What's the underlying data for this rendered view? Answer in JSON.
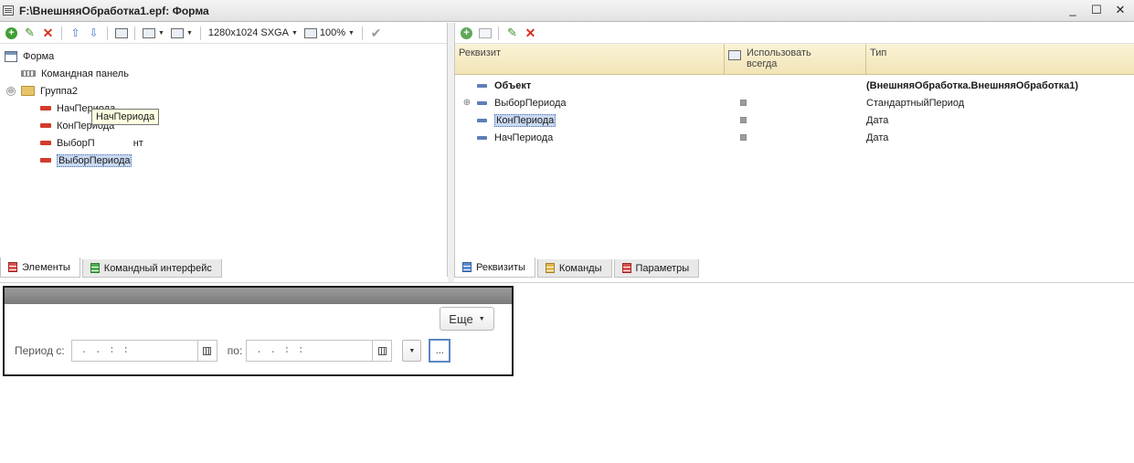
{
  "window": {
    "title": "F:\\ВнешняяОбработка1.epf: Форма",
    "controls": {
      "minimize": "_",
      "maximize": "☐",
      "close": "✕"
    }
  },
  "left_toolbar": {
    "resolution": "1280x1024 SXGA",
    "zoom": "100%"
  },
  "element_tree": {
    "items": [
      {
        "label": "Форма",
        "icon": "form-icon",
        "indent": 0
      },
      {
        "label": "Командная панель",
        "icon": "command-panel-icon",
        "indent": 1
      },
      {
        "label": "Группа2",
        "icon": "folder-icon",
        "indent": 0,
        "expander": "⊖"
      },
      {
        "label": "НачПериода",
        "icon": "field-icon",
        "indent": 2
      },
      {
        "label": "КонПериода",
        "icon": "field-icon",
        "indent": 2
      },
      {
        "label": "ВыборПериодаЭлемент",
        "visible_prefix": "ВыборП",
        "visible_suffix": "нт",
        "icon": "field-icon",
        "indent": 2
      },
      {
        "label": "ВыборПериода",
        "icon": "field-icon",
        "indent": 2,
        "selected": true
      }
    ],
    "tooltip": "НачПериода"
  },
  "left_tabs": [
    {
      "label": "Элементы",
      "icon": "elements-tab-icon",
      "active": true
    },
    {
      "label": "Командный интерфейс",
      "icon": "command-interface-tab-icon",
      "active": false
    }
  ],
  "attributes_grid": {
    "headers": {
      "name": "Реквизит",
      "use_always_line1": "Использовать",
      "use_always_line2": "всегда",
      "type": "Тип"
    },
    "rows": [
      {
        "name": "Объект",
        "type": "(ВнешняяОбработка.ВнешняяОбработка1)",
        "bold": true,
        "check": false,
        "expand": ""
      },
      {
        "name": "ВыборПериода",
        "type": "СтандартныйПериод",
        "bold": false,
        "check": true,
        "expand": "⊕"
      },
      {
        "name": "КонПериода",
        "type": "Дата",
        "bold": false,
        "check": true,
        "expand": "",
        "selected": true
      },
      {
        "name": "НачПериода",
        "type": "Дата",
        "bold": false,
        "check": true,
        "expand": ""
      }
    ]
  },
  "right_tabs": [
    {
      "label": "Реквизиты",
      "icon": "attributes-tab-icon",
      "active": true
    },
    {
      "label": "Команды",
      "icon": "commands-tab-icon",
      "active": false
    },
    {
      "label": "Параметры",
      "icon": "parameters-tab-icon",
      "active": false
    }
  ],
  "form_preview": {
    "more_button": "Еще",
    "period_from_label": "Период с:",
    "period_to_label": "по:",
    "date_mask": ".  .     :  :",
    "ellipsis_button": "..."
  }
}
